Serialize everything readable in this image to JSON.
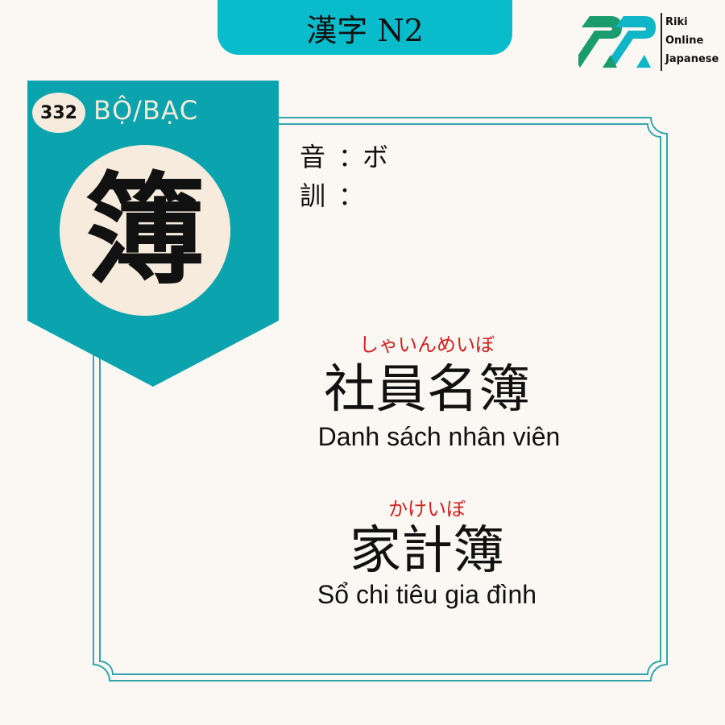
{
  "header": {
    "title": "漢字 N2"
  },
  "logo": {
    "line1": "Riki",
    "line2": "Online",
    "line3": "Japanese",
    "colors": [
      "#1b9c6e",
      "#0fb6c8"
    ]
  },
  "card": {
    "number": "332",
    "radical_name": "BỘ/BẠC",
    "kanji": "簿",
    "on_label": "音",
    "on_sep": "：",
    "on_reading": "ボ",
    "kun_label": "訓",
    "kun_sep": "：",
    "kun_reading": ""
  },
  "examples": [
    {
      "reading": "しゃいんめいぼ",
      "word": "社員名簿",
      "meaning": "Danh sách nhân viên"
    },
    {
      "reading": "かけいぼ",
      "word": "家計簿",
      "meaning": "Sổ chi tiêu gia đình"
    }
  ],
  "colors": {
    "teal": "#08b3bf",
    "banner": "#0aa3ae",
    "cream": "#f6ebdc",
    "accent_red": "#d12020",
    "background": "#fbf8f3"
  }
}
